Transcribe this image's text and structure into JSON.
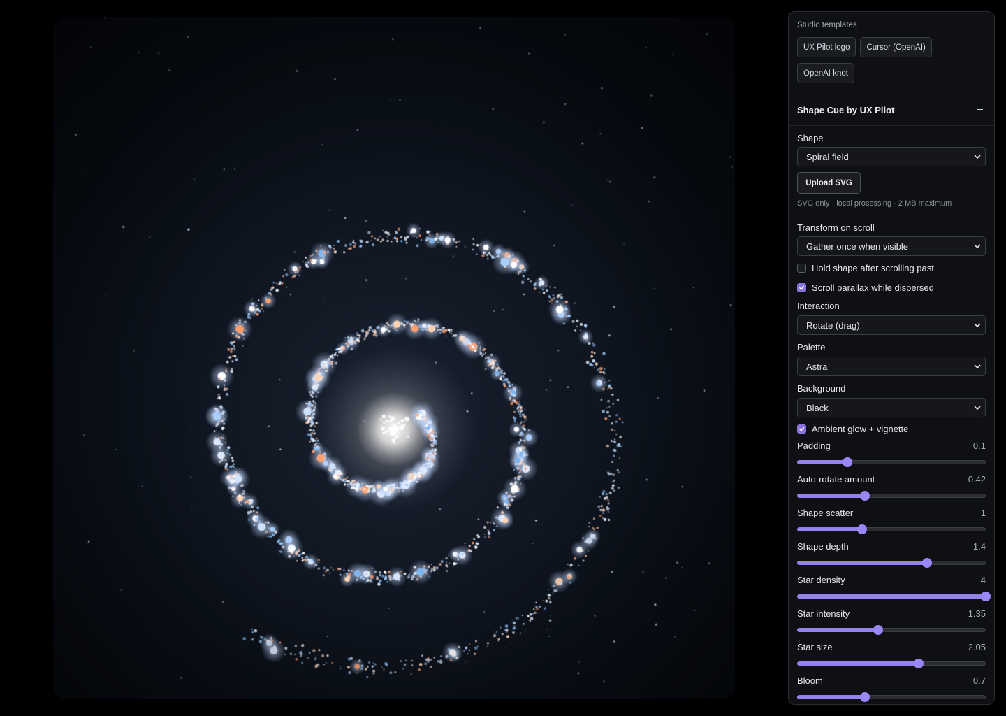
{
  "templates": {
    "caption": "Studio templates",
    "items": [
      "UX Pilot logo",
      "Cursor (OpenAI)",
      "OpenAI knot"
    ]
  },
  "section": {
    "title": "Shape Cue by UX Pilot"
  },
  "shape": {
    "label": "Shape",
    "value": "Spiral field",
    "upload_label": "Upload SVG",
    "hint": "SVG only · local processing · 2 MB maximum"
  },
  "transform": {
    "label": "Transform on scroll",
    "value": "Gather once when visible"
  },
  "checks": [
    {
      "label": "Hold shape after scrolling past",
      "checked": false
    },
    {
      "label": "Scroll parallax while dispersed",
      "checked": true
    }
  ],
  "interaction": {
    "label": "Interaction",
    "value": "Rotate (drag)"
  },
  "palette": {
    "label": "Palette",
    "value": "Astra"
  },
  "background": {
    "label": "Background",
    "value": "Black"
  },
  "ambient": {
    "label": "Ambient glow + vignette",
    "checked": true
  },
  "sliders": [
    {
      "label": "Padding",
      "value": "0.1",
      "fraction": 0.265
    },
    {
      "label": "Auto-rotate amount",
      "value": "0.42",
      "fraction": 0.36
    },
    {
      "label": "Shape scatter",
      "value": "1",
      "fraction": 0.345
    },
    {
      "label": "Shape depth",
      "value": "1.4",
      "fraction": 0.69
    },
    {
      "label": "Star density",
      "value": "4",
      "fraction": 1.0
    },
    {
      "label": "Star intensity",
      "value": "1.35",
      "fraction": 0.43
    },
    {
      "label": "Star size",
      "value": "2.05",
      "fraction": 0.645
    },
    {
      "label": "Bloom",
      "value": "0.7",
      "fraction": 0.36
    }
  ],
  "colors": {
    "accent": "#9381ee",
    "panel": "#0f1013",
    "border": "#2a2c31"
  },
  "icons": [
    "chevron-down-icon",
    "minus-icon",
    "check-icon"
  ]
}
